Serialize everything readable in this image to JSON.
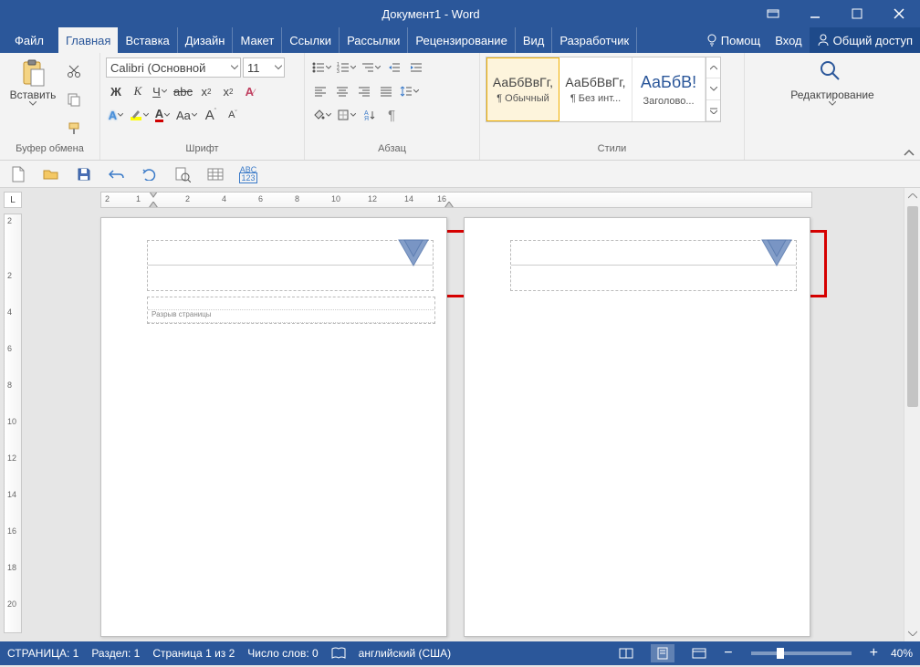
{
  "title": "Документ1 - Word",
  "tabs": {
    "file": "Файл",
    "home": "Главная",
    "insert": "Вставка",
    "design": "Дизайн",
    "layout": "Макет",
    "references": "Ссылки",
    "mailings": "Рассылки",
    "review": "Рецензирование",
    "view": "Вид",
    "developer": "Разработчик",
    "help": "Помощ",
    "signin": "Вход",
    "share": "Общий доступ"
  },
  "ribbon": {
    "clipboard": {
      "label": "Буфер обмена",
      "paste": "Вставить"
    },
    "font": {
      "label": "Шрифт",
      "name": "Calibri (Основной",
      "size": "11",
      "bold": "Ж",
      "italic": "К",
      "underline": "Ч",
      "strike": "abc",
      "subscript": "x",
      "superscript": "x",
      "case": "Aa",
      "grow": "A",
      "shrink": "A",
      "texteffects": "A",
      "highlight": "ab",
      "fontcolor": "A"
    },
    "paragraph": {
      "label": "Абзац"
    },
    "styles": {
      "label": "Стили",
      "items": [
        {
          "preview": "АаБбВвГг,",
          "name": "¶ Обычный",
          "selected": true,
          "color": "#333"
        },
        {
          "preview": "АаБбВвГг,",
          "name": "¶ Без инт...",
          "selected": false,
          "color": "#333"
        },
        {
          "preview": "АаБбВ!",
          "name": "Заголово...",
          "selected": false,
          "color": "#2b579a"
        }
      ]
    },
    "editing": {
      "label": "Редактирование"
    }
  },
  "ruler": {
    "h_numbers": [
      "2",
      "1",
      "2",
      "4",
      "6",
      "8",
      "10",
      "12",
      "14",
      "16"
    ],
    "v_numbers": [
      "2",
      "2",
      "4",
      "6",
      "8",
      "10",
      "12",
      "14",
      "16",
      "18",
      "20"
    ]
  },
  "document": {
    "page_break_label": "Разрыв страницы"
  },
  "status": {
    "page": "СТРАНИЦА: 1",
    "section": "Раздел: 1",
    "page_of": "Страница 1 из 2",
    "words": "Число слов: 0",
    "language": "английский (США)",
    "zoom": "40%",
    "zoom_minus": "−",
    "zoom_plus": "+"
  }
}
